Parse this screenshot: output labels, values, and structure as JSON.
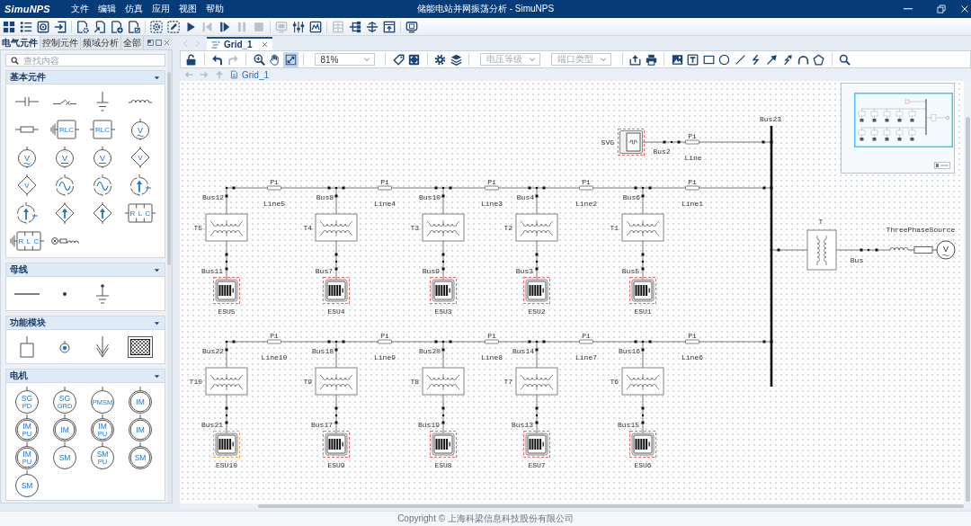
{
  "window": {
    "logo": "SimuNPS",
    "menu": [
      "文件",
      "编辑",
      "仿真",
      "应用",
      "视图",
      "帮助"
    ],
    "title": "储能电站并网振荡分析 - SimuNPS"
  },
  "toolbar": [
    [
      {
        "kind": "tiles",
        "disabled": false
      },
      {
        "kind": "list",
        "disabled": false
      },
      {
        "kind": "target-frame",
        "disabled": false
      },
      {
        "kind": "import",
        "disabled": false
      }
    ],
    [
      {
        "kind": "document-gear",
        "disabled": false
      },
      {
        "kind": "document-link",
        "disabled": false
      },
      {
        "kind": "document-add",
        "disabled": false
      },
      {
        "kind": "document-export",
        "disabled": false
      }
    ],
    [
      {
        "kind": "gear-frame",
        "disabled": false
      },
      {
        "kind": "pencil-frame",
        "disabled": false
      },
      {
        "kind": "play",
        "disabled": false
      },
      {
        "kind": "step-back",
        "disabled": true
      },
      {
        "kind": "step-forward",
        "disabled": false
      },
      {
        "kind": "pause",
        "disabled": true
      },
      {
        "kind": "stop",
        "disabled": true
      }
    ],
    [
      {
        "kind": "monitor",
        "disabled": true
      },
      {
        "kind": "sliders",
        "disabled": false
      },
      {
        "kind": "chart-window",
        "disabled": false
      }
    ],
    [
      {
        "kind": "table",
        "disabled": true
      },
      {
        "kind": "tree",
        "disabled": false
      },
      {
        "kind": "crosshair",
        "disabled": false
      },
      {
        "kind": "frame-upload",
        "disabled": false
      }
    ],
    [
      {
        "kind": "screen",
        "disabled": false
      }
    ]
  ],
  "library": {
    "tabs": [
      {
        "label": "电气元件",
        "selected": true
      },
      {
        "label": "控制元件",
        "selected": false
      },
      {
        "label": "频域分析",
        "selected": false
      },
      {
        "label": "全部",
        "selected": false
      }
    ],
    "search": {
      "placeholder": "查找内容"
    },
    "sections": [
      {
        "title": "基本元件",
        "expanded": true,
        "items": [
          {
            "kind": "capacitor"
          },
          {
            "kind": "breaker"
          },
          {
            "kind": "ground"
          },
          {
            "kind": "inductor"
          },
          {
            "kind": "resistor"
          },
          {
            "kind": "rlc-grounded",
            "symbol": "RLC"
          },
          {
            "kind": "rlc",
            "symbol": "RLC"
          },
          {
            "kind": "ac-voltage-source",
            "symbol": "V"
          },
          {
            "kind": "ac-voltage-source",
            "symbol": "V"
          },
          {
            "kind": "dc-voltage-source",
            "symbol": "V"
          },
          {
            "kind": "dc-voltage-source",
            "symbol": "V"
          },
          {
            "kind": "controlled-voltage-source",
            "symbol": "V"
          },
          {
            "kind": "controlled-voltage-source",
            "symbol": "V"
          },
          {
            "kind": "ac-current-source"
          },
          {
            "kind": "ac-current-source"
          },
          {
            "kind": "current-source"
          },
          {
            "kind": "current-source"
          },
          {
            "kind": "controlled-current-source"
          },
          {
            "kind": "controlled-current-source"
          },
          {
            "kind": "rlc-series",
            "symbol": "RLC"
          },
          {
            "kind": "rlc-series-grounded",
            "symbol": "RLC"
          },
          {
            "kind": "machine-coil"
          }
        ]
      },
      {
        "title": "母线",
        "expanded": true,
        "items": [
          {
            "kind": "busbar"
          },
          {
            "kind": "node"
          },
          {
            "kind": "grounded-node"
          }
        ]
      },
      {
        "title": "功能模块",
        "expanded": true,
        "items": [
          {
            "kind": "subsystem"
          },
          {
            "kind": "port"
          },
          {
            "kind": "down-arrow"
          },
          {
            "kind": "hatched-box"
          }
        ]
      },
      {
        "title": "电机",
        "expanded": true,
        "items": [
          {
            "kind": "machine",
            "symbol": "SG",
            "sub": "PD"
          },
          {
            "kind": "machine",
            "symbol": "SG",
            "sub": "GRD"
          },
          {
            "kind": "machine",
            "symbol": "PMSM"
          },
          {
            "kind": "double-ring-machine",
            "symbol": "IM"
          },
          {
            "kind": "double-ring-machine",
            "symbol": "IM",
            "sub": "PU"
          },
          {
            "kind": "double-ring-machine",
            "symbol": "IM"
          },
          {
            "kind": "double-ring-machine",
            "symbol": "IM",
            "sub": "PU"
          },
          {
            "kind": "double-ring-machine",
            "symbol": "IM"
          },
          {
            "kind": "double-ring-machine",
            "symbol": "IM",
            "sub": "PU"
          },
          {
            "kind": "machine",
            "symbol": "SM"
          },
          {
            "kind": "machine",
            "symbol": "SM",
            "sub": "PU"
          },
          {
            "kind": "double-ring-machine",
            "symbol": "SM"
          },
          {
            "kind": "machine",
            "symbol": "SM"
          }
        ]
      }
    ]
  },
  "editor": {
    "tab_nav": [
      {
        "kind": "chevron-left",
        "disabled": true
      },
      {
        "kind": "chevron-right",
        "disabled": true
      }
    ],
    "tabs": [
      {
        "label": "Grid_1",
        "selected": true
      }
    ],
    "tools": [
      [
        {
          "kind": "lock-open",
          "disabled": false,
          "selected": false
        }
      ],
      [
        {
          "kind": "undo",
          "disabled": false,
          "selected": false
        },
        {
          "kind": "redo",
          "disabled": true,
          "selected": false
        }
      ],
      [
        {
          "kind": "zoom-in",
          "disabled": false,
          "selected": false
        },
        {
          "kind": "hand",
          "disabled": false,
          "selected": false
        },
        {
          "kind": "fit",
          "disabled": false,
          "selected": true
        }
      ],
      [
        {
          "kind": "dropdown",
          "value": "81%"
        }
      ],
      [
        {
          "kind": "tag",
          "disabled": false,
          "selected": false
        },
        {
          "kind": "fit-screen",
          "disabled": false,
          "selected": false
        }
      ],
      [
        {
          "kind": "gear",
          "disabled": false,
          "selected": false
        },
        {
          "kind": "layers",
          "disabled": false,
          "selected": false
        }
      ],
      [
        {
          "kind": "dropdown",
          "placeholder": "电压等级"
        },
        {
          "kind": "dropdown",
          "placeholder": "端口类型"
        }
      ],
      [
        {
          "kind": "upload",
          "disabled": false,
          "selected": false
        },
        {
          "kind": "printer",
          "disabled": false,
          "selected": false
        }
      ],
      [
        {
          "kind": "image",
          "disabled": false,
          "selected": false
        },
        {
          "kind": "text-box",
          "disabled": false,
          "selected": false
        },
        {
          "kind": "rectangle",
          "disabled": false,
          "selected": false
        },
        {
          "kind": "circle",
          "disabled": false,
          "selected": false
        },
        {
          "kind": "line",
          "disabled": false,
          "selected": false
        },
        {
          "kind": "zigzag",
          "disabled": false,
          "selected": false
        },
        {
          "kind": "arrow",
          "disabled": false,
          "selected": false
        },
        {
          "kind": "lightning-arrow",
          "disabled": false,
          "selected": false
        },
        {
          "kind": "arc",
          "disabled": false,
          "selected": false
        },
        {
          "kind": "pentagon",
          "disabled": false,
          "selected": false
        }
      ],
      [
        {
          "kind": "search",
          "disabled": false,
          "selected": false
        }
      ]
    ],
    "breadcrumb": {
      "nav": [
        {
          "kind": "arrow-left",
          "disabled": true
        },
        {
          "kind": "arrow-right",
          "disabled": true
        },
        {
          "kind": "arrow-up",
          "disabled": true
        }
      ],
      "path": "Grid_1"
    }
  },
  "diagram": {
    "main_bus": "Bus23",
    "svg_branch": {
      "name": "SVG",
      "color": "#f06a6a",
      "bus": "Bus2",
      "line_type": "Pi",
      "line": "Line"
    },
    "rows": [
      {
        "units": [
          {
            "bus": "Bus12",
            "transformer": "T5",
            "esu_bus": "Bus11",
            "esu": "ESU5",
            "color": "#f06a6a",
            "line_type": "Pi",
            "line": "Line5"
          },
          {
            "bus": "Bus8",
            "transformer": "T4",
            "esu_bus": "Bus7",
            "esu": "ESU4",
            "color": "#f06a6a",
            "line_type": "Pi",
            "line": "Line4"
          },
          {
            "bus": "Bus10",
            "transformer": "T3",
            "esu_bus": "Bus9",
            "esu": "ESU3",
            "color": "#f06a6a",
            "line_type": "Pi",
            "line": "Line3"
          },
          {
            "bus": "Bus4",
            "transformer": "T2",
            "esu_bus": "Bus3",
            "esu": "ESU2",
            "color": "#f06a6a",
            "line_type": "Pi",
            "line": "Line2"
          },
          {
            "bus": "Bus6",
            "transformer": "T1",
            "esu_bus": "Bus5",
            "esu": "ESU1",
            "color": "#f06a6a",
            "line_type": "Pi",
            "line": "Line1"
          }
        ]
      },
      {
        "units": [
          {
            "bus": "Bus22",
            "transformer": "T10",
            "esu_bus": "Bus21",
            "esu": "ESU10",
            "color": "#f5a84a",
            "line_type": "Pi",
            "line": "Line10"
          },
          {
            "bus": "Bus18",
            "transformer": "T9",
            "esu_bus": "Bus17",
            "esu": "ESU9",
            "color": "#f06a6a",
            "line_type": "Pi",
            "line": "Line9"
          },
          {
            "bus": "Bus20",
            "transformer": "T8",
            "esu_bus": "Bus19",
            "esu": "ESU8",
            "color": "#f06a6a",
            "line_type": "Pi",
            "line": "Line8"
          },
          {
            "bus": "Bus14",
            "transformer": "T7",
            "esu_bus": "Bus13",
            "esu": "ESU7",
            "color": "#f06a6a",
            "line_type": "Pi",
            "line": "Line7"
          },
          {
            "bus": "Bus16",
            "transformer": "T6",
            "esu_bus": "Bus15",
            "esu": "ESU6",
            "color": "#f06a6a",
            "line_type": "Pi",
            "line": "Line6"
          }
        ]
      }
    ],
    "source_branch": {
      "transformer": "T",
      "bus": "Bus",
      "source": "ThreePhaseSource",
      "symbol": "V"
    }
  },
  "footer": {
    "text": "Copyright © 上海科梁信息科技股份有限公司"
  }
}
